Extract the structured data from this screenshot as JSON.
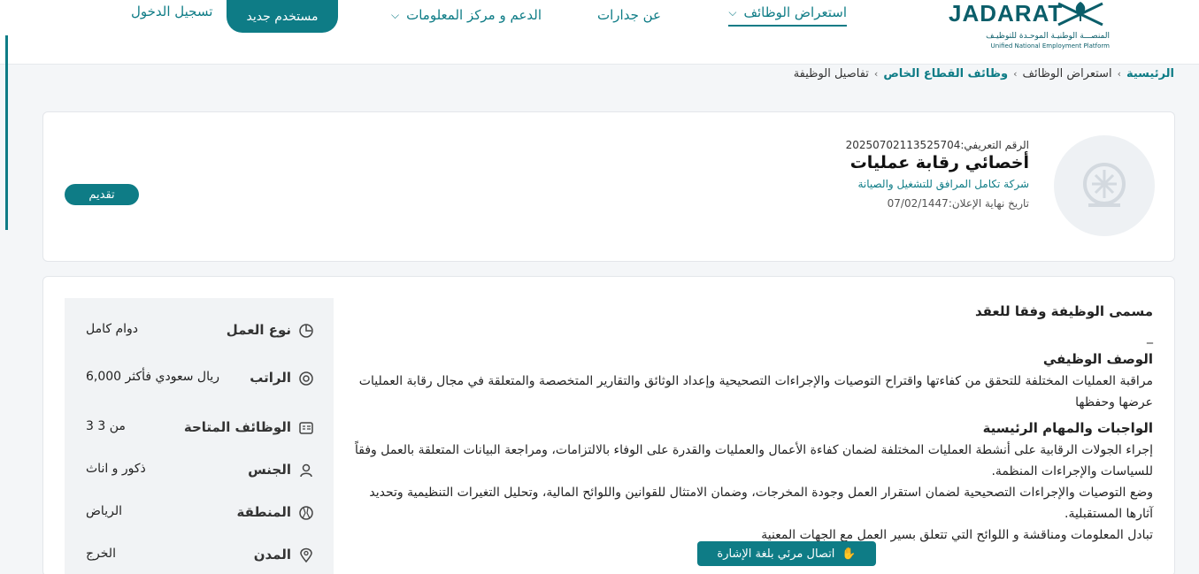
{
  "header": {
    "brand": "JADARAT",
    "brand_sub_ar": "المنصـــة الوطنيـة الموحـدة للتوظيـف",
    "brand_sub_en": "Unified National Employment Platform",
    "nav": {
      "jobs": "استعراض الوظائف",
      "about": "عن جدارات",
      "support": "الدعم و مركز المعلومات"
    },
    "register_label": "مستخدم جديد",
    "login_label": "تسجيل الدخول"
  },
  "breadcrumb": {
    "home": "الرئيسية",
    "jobs": "استعراض الوظائف",
    "private": "وظائف القطاع الخاص",
    "current": "تفاصيل الوظيفة"
  },
  "job": {
    "id_line": "الرقم التعريفي:20250702113525704",
    "title": "أخصائي رقابة عمليات",
    "company": "شركة تكامل المرافق للتشغيل والصيانة",
    "deadline_line": "تاريخ نهاية الإعلان:07/02/1447",
    "apply_label": "تقديم"
  },
  "attributes": [
    {
      "label": "نوع العمل",
      "value": "دوام كامل",
      "icon": "clock-icon"
    },
    {
      "label": "الراتب",
      "value": "6,000 ريال سعودي فأكثر",
      "icon": "salary-icon"
    },
    {
      "label": "الوظائف المتاحة",
      "value": "3 من 3",
      "icon": "id-card-icon"
    },
    {
      "label": "الجنس",
      "value": "ذكور و اناث",
      "icon": "person-icon"
    },
    {
      "label": "المنطقة",
      "value": "الرياض",
      "icon": "map-icon"
    },
    {
      "label": "المدن",
      "value": "الخرج",
      "icon": "location-pin-icon"
    }
  ],
  "content": {
    "contract_title_heading": "مسمى الوظيفة وفقا للعقد",
    "contract_title_value": "_",
    "description_heading": "الوصف الوظيفي",
    "description": "مراقبة العمليات المختلفة للتحقق من كفاءتها واقتراح التوصيات والإجراءات التصحيحية وإعداد الوثائق والتقارير المتخصصة والمتعلقة في مجال رقابة العمليات عرضها وحفظها",
    "duties_heading": "الواجبات والمهام الرئيسية",
    "duty_1": "إجراء الجولات الرقابية على أنشطة العمليات المختلفة لضمان كفاءة الأعمال والعمليات والقدرة على الوفاء بالالتزامات، ومراجعة البيانات المتعلقة بالعمل وفقاً للسياسات والإجراءات المنظمة.",
    "duty_2": "وضع التوصيات والإجراءات التصحيحية لضمان استقرار العمل وجودة المخرجات، وضمان الامتثال للقوانين واللوائح المالية، وتحليل التغيرات التنظيمية وتحديد آثارها المستقبلية.",
    "duty_3": "تبادل المعلومات ومناقشة و اللوائح التي تتعلق بسير العمل مع الجهات المعنية"
  },
  "video_call_label": "اتصال مرئي بلغة الإشارة"
}
